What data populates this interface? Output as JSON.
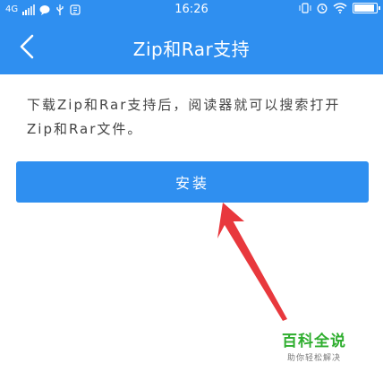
{
  "status_bar": {
    "network": "4G",
    "time": "16:26"
  },
  "header": {
    "title": "Zip和Rar支持"
  },
  "main": {
    "description": "下载Zip和Rar支持后，阅读器就可以搜索打开Zip和Rar文件。",
    "install_button": "安装"
  },
  "watermark": {
    "title": "百科全说",
    "subtitle": "助你轻松解决"
  },
  "colors": {
    "primary": "#2f8ff0",
    "annotation_arrow": "#e8383d",
    "watermark_green": "#2fae2f"
  }
}
